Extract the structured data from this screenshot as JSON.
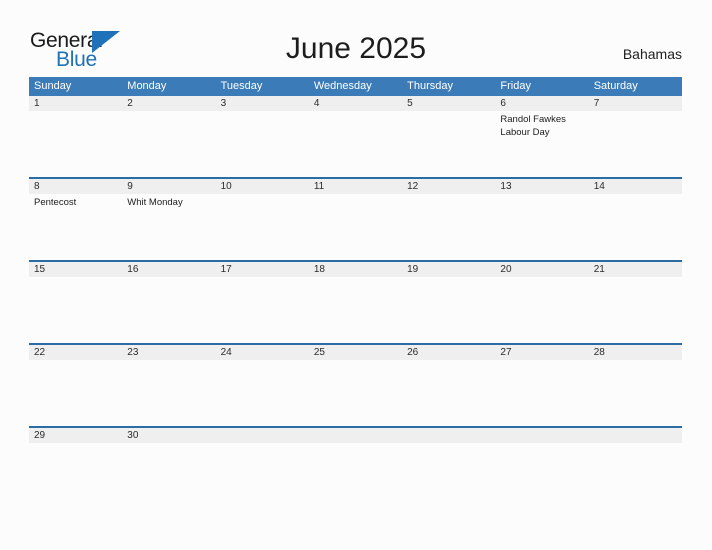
{
  "brand": {
    "word_one": "General",
    "word_two": "Blue",
    "flag_icon": "triangle-flag-icon",
    "accent_color": "#1f71b8"
  },
  "header": {
    "title": "June 2025",
    "country": "Bahamas"
  },
  "colors": {
    "header_blue": "#3b7cb8",
    "row_rule_blue": "#2c6ca4",
    "daynum_band_gray": "#efefef",
    "page_background": "#fcfcfc",
    "text_dark": "#1d1d1d",
    "text_white": "#ffffff"
  },
  "calendar": {
    "month": "June",
    "year": "2025",
    "weekday_headers": [
      "Sunday",
      "Monday",
      "Tuesday",
      "Wednesday",
      "Thursday",
      "Friday",
      "Saturday"
    ],
    "weeks": [
      {
        "days": [
          {
            "number": "1",
            "events": []
          },
          {
            "number": "2",
            "events": []
          },
          {
            "number": "3",
            "events": []
          },
          {
            "number": "4",
            "events": []
          },
          {
            "number": "5",
            "events": []
          },
          {
            "number": "6",
            "events": [
              "Randol Fawkes Labour Day"
            ]
          },
          {
            "number": "7",
            "events": []
          }
        ]
      },
      {
        "days": [
          {
            "number": "8",
            "events": [
              "Pentecost"
            ]
          },
          {
            "number": "9",
            "events": [
              "Whit Monday"
            ]
          },
          {
            "number": "10",
            "events": []
          },
          {
            "number": "11",
            "events": []
          },
          {
            "number": "12",
            "events": []
          },
          {
            "number": "13",
            "events": []
          },
          {
            "number": "14",
            "events": []
          }
        ]
      },
      {
        "days": [
          {
            "number": "15",
            "events": []
          },
          {
            "number": "16",
            "events": []
          },
          {
            "number": "17",
            "events": []
          },
          {
            "number": "18",
            "events": []
          },
          {
            "number": "19",
            "events": []
          },
          {
            "number": "20",
            "events": []
          },
          {
            "number": "21",
            "events": []
          }
        ]
      },
      {
        "days": [
          {
            "number": "22",
            "events": []
          },
          {
            "number": "23",
            "events": []
          },
          {
            "number": "24",
            "events": []
          },
          {
            "number": "25",
            "events": []
          },
          {
            "number": "26",
            "events": []
          },
          {
            "number": "27",
            "events": []
          },
          {
            "number": "28",
            "events": []
          }
        ]
      },
      {
        "days": [
          {
            "number": "29",
            "events": []
          },
          {
            "number": "30",
            "events": []
          },
          {
            "number": "",
            "events": []
          },
          {
            "number": "",
            "events": []
          },
          {
            "number": "",
            "events": []
          },
          {
            "number": "",
            "events": []
          },
          {
            "number": "",
            "events": []
          }
        ]
      }
    ]
  }
}
